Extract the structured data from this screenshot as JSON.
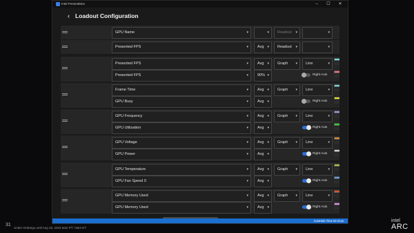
{
  "window": {
    "title": "Intel PresentMon",
    "controls": {
      "minimize": "–",
      "maximize": "☐",
      "close": "✕"
    }
  },
  "header": {
    "title": "Loadout Configuration",
    "back": "‹"
  },
  "rows": [
    {
      "metric": "GPU Name",
      "stat": "",
      "type": "Readout",
      "style": "",
      "type_disabled": true,
      "stat_empty": true
    },
    {
      "metric": "Presented FPS",
      "stat": "Avg",
      "type": "Readout",
      "style": ""
    },
    {
      "metric": "Presented FPS",
      "stat": "Avg",
      "type": "Graph",
      "style": "Line",
      "color": "#6fd8df",
      "sub": {
        "metric": "Presented FPS",
        "stat": "90%",
        "right_axis": false,
        "right_axis_label": "Right Axis",
        "color": "#f07077"
      }
    },
    {
      "metric": "Frame Time",
      "stat": "Avg",
      "type": "Graph",
      "style": "Line",
      "color": "#6fd8df",
      "sub": {
        "metric": "GPU Busy",
        "stat": "Avg",
        "right_axis": false,
        "right_axis_label": "Right Axis",
        "color": "#e6e21c"
      }
    },
    {
      "metric": "GPU Frequency",
      "stat": "Avg",
      "type": "Graph",
      "style": "Line",
      "color": "#8a99e6",
      "sub": {
        "metric": "GPU Utilization",
        "stat": "Avg",
        "right_axis": true,
        "right_axis_label": "Right Axis",
        "color": "#2bd62b"
      }
    },
    {
      "metric": "GPU Voltage",
      "stat": "Avg",
      "type": "Graph",
      "style": "Line",
      "color": "#e68a2b",
      "sub": {
        "metric": "GPU Power",
        "stat": "Avg",
        "right_axis": true,
        "right_axis_label": "Right Axis",
        "color": "#d4d4d4"
      }
    },
    {
      "metric": "GPU Temperature",
      "stat": "Avg",
      "type": "Graph",
      "style": "Line",
      "color": "#b5c23a",
      "sub": {
        "metric": "GPU Fan Speed 0",
        "stat": "Avg",
        "right_axis": true,
        "right_axis_label": "Right Axis",
        "color": "#5ea0e6"
      }
    },
    {
      "metric": "GPU Memory Used",
      "stat": "Avg",
      "type": "Graph",
      "style": "Line",
      "color": "#e0521e",
      "sub": {
        "metric": "GPU Memory Used",
        "stat": "Avg",
        "right_axis": true,
        "right_axis_label": "Right Axis",
        "color": "#d68ee0"
      }
    }
  ],
  "taskbar": {
    "text": "AutoHide  Time  62.01us"
  },
  "slide": {
    "number": "31",
    "footer": "Under embargo until Aug 15, 2023 6am PT / 9am ET",
    "brand_top": "intel",
    "brand_bottom": "ARC"
  }
}
